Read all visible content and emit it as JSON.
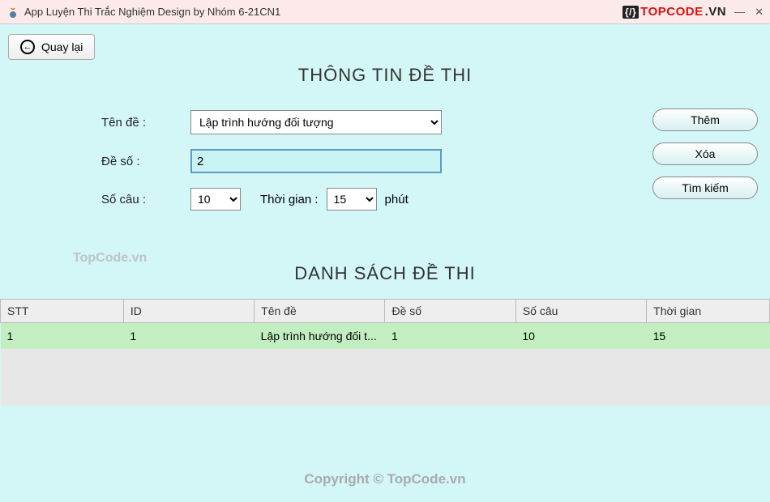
{
  "window": {
    "title": "App Luyện Thi Trắc Nghiệm Design by Nhóm 6-21CN1",
    "logo_text": "TOPCODE",
    "logo_suffix": ".VN",
    "minimize": "—",
    "close": "✕"
  },
  "back_button": "Quay lại",
  "section1_title": "THÔNG TIN ĐỀ THI",
  "form": {
    "label_tende": "Tên đề   :",
    "tende_value": "Lập trình hướng đối tượng",
    "label_deso": "Đề số    :",
    "deso_value": "2",
    "label_socau": "Số câu   :",
    "socau_value": "10",
    "label_thoigian": "Thời gian  :",
    "thoigian_value": "15",
    "unit_phut": "phút"
  },
  "buttons": {
    "them": "Thêm",
    "xoa": "Xóa",
    "timkiem": "Tìm kiếm"
  },
  "watermark1": "TopCode.vn",
  "section2_title": "DANH SÁCH ĐỀ THI",
  "table": {
    "headers": [
      "STT",
      "ID",
      "Tên đề",
      "Đề số",
      "Số câu",
      "Thời gian"
    ],
    "rows": [
      {
        "stt": "1",
        "id": "1",
        "tende": "Lập trình hướng đối t...",
        "deso": "1",
        "socau": "10",
        "thoigian": "15"
      }
    ]
  },
  "copyright": "Copyright © TopCode.vn"
}
